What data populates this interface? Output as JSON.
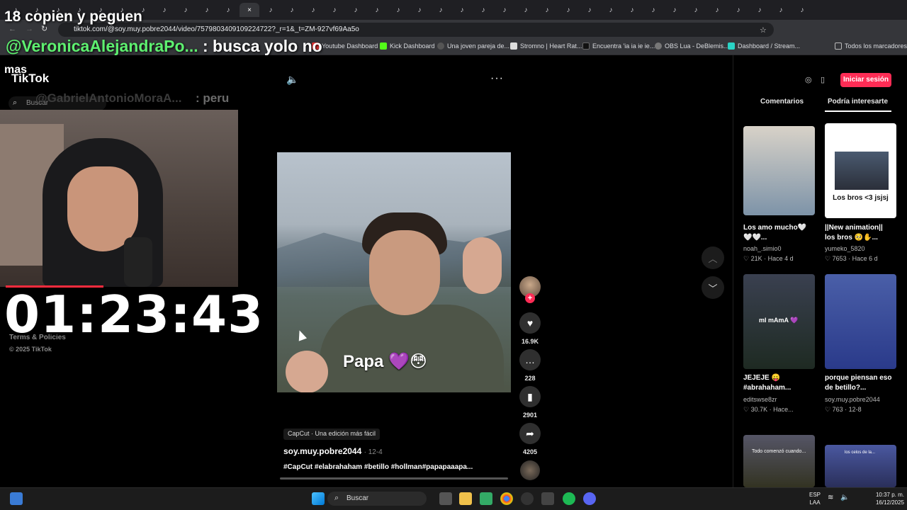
{
  "browser": {
    "url": "tiktok.com/@soy.muy.pobre2044/video/7579803409109224722?_r=1&_t=ZM-927vf69Aa5o",
    "bookmarks": [
      "Youtube Dashboard",
      "Kick Dashboard",
      "Una joven pareja de...",
      "Stromno | Heart Rat...",
      "Encuentra 'ia ia ie ie...",
      "OBS Lua - DeBlemis...",
      "Dashboard / Stream..."
    ],
    "all_bookmarks": "Todos los marcadores"
  },
  "tiktok": {
    "logo": "TikTok",
    "search_placeholder": "Buscar",
    "terms": "Terms & Policies",
    "copyright": "© 2025 TikTok",
    "login": "Iniciar sesión",
    "tabs": [
      "Comentarios",
      "Podría interesarte"
    ],
    "video": {
      "caption": "Papa",
      "caption_emoji": "💜😳",
      "likes": "16.9K",
      "comments": "228",
      "saves": "2901",
      "shares": "4205",
      "capcut": "CapCut · Una edición más fácil",
      "author": "soy.muy.pobre2044",
      "date": "· 12-4",
      "tags": "#CapCut #elabrahaham #betillo #hollman#papapaaapa..."
    },
    "recommendations": [
      {
        "title": "Los amo mucho🤍🤍🤍...",
        "user": "noah_.simio0",
        "stats": "♡ 21K · Hace 4 d",
        "overlay": ""
      },
      {
        "title": "||New animation|| los bros 🥺✋...",
        "user": "yumeko_5820",
        "stats": "♡ 7653 · Hace 6 d",
        "overlay": "Los bros <3 jsjsj"
      },
      {
        "title": "JEJEJE 😛 #abrahaham...",
        "user": "editswse8zr",
        "stats": "♡ 30.7K · Hace...",
        "overlay": "mI mAmA 💜"
      },
      {
        "title": "porque piensan eso de betillo?...",
        "user": "soy.muy.pobre2044",
        "stats": "♡ 763 · 12-8",
        "overlay": ""
      },
      {
        "title": "",
        "user": "",
        "stats": "",
        "overlay": "Todo comenzó cuando..."
      },
      {
        "title": "",
        "user": "",
        "stats": "",
        "overlay": "los celos de la..."
      }
    ]
  },
  "overlay": {
    "title": "18 copien y peguen",
    "chat1_user": "@VeronicaAlejandraPo...",
    "chat1_msg": ": busca yolo no",
    "chat1_cont": "mas",
    "chat2_user": "@GabrielAntonioMoraA...",
    "chat2_msg": ": peru",
    "timer": "01:23:43"
  },
  "taskbar": {
    "search": "Buscar",
    "lang": "ESP\nLAA",
    "time": "10:37 p. m.",
    "date": "16/12/2025"
  },
  "colors": {
    "brand": "#fe2c55",
    "chat_user": "#5ef070"
  }
}
